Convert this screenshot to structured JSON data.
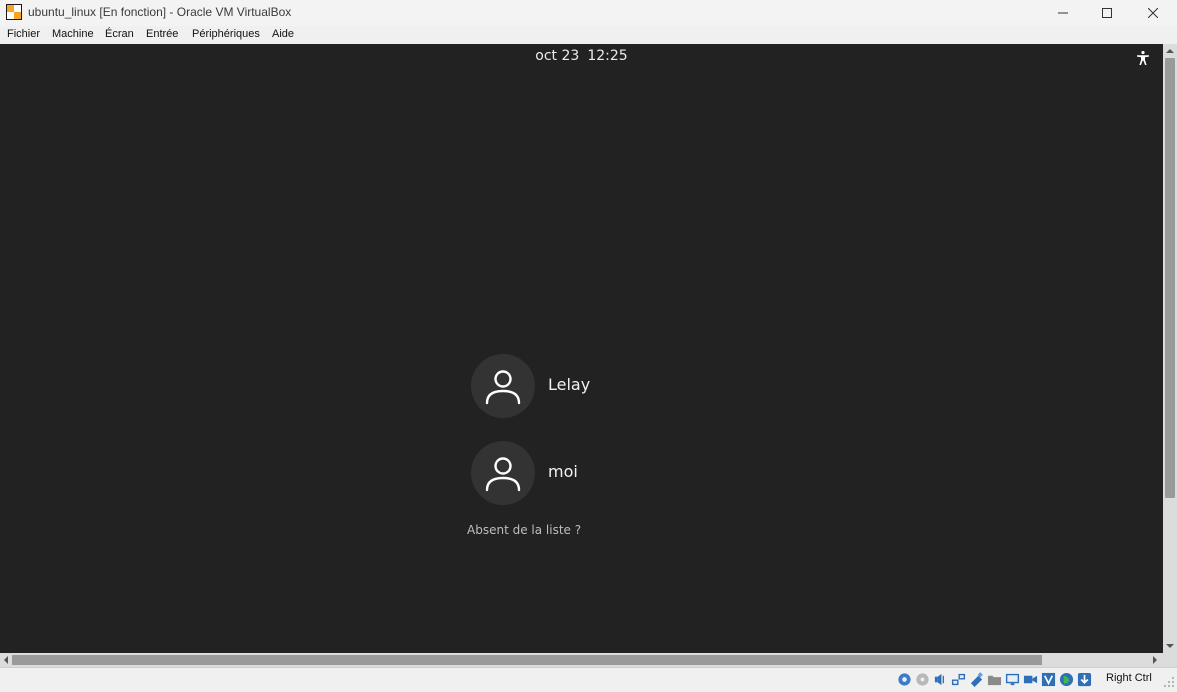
{
  "window": {
    "title": "ubuntu_linux [En fonction] - Oracle VM VirtualBox"
  },
  "menu": {
    "items": [
      {
        "label": "Fichier"
      },
      {
        "label": "Machine"
      },
      {
        "label": "Écran"
      },
      {
        "label": "Entrée"
      },
      {
        "label": "Périphériques"
      },
      {
        "label": "Aide"
      }
    ]
  },
  "login": {
    "date": "oct 23",
    "time": "12:25",
    "users": [
      {
        "name": "Lelay"
      },
      {
        "name": "moi"
      }
    ],
    "not_listed": "Absent de la liste ?"
  },
  "statusbar": {
    "host_key": "Right Ctrl",
    "icons": [
      "hard-disk-icon",
      "optical-drive-icon",
      "audio-icon",
      "network-icon",
      "usb-icon",
      "shared-folders-icon",
      "display-icon",
      "video-capture-icon",
      "virtualization-icon",
      "mouse-integration-icon",
      "host-key-icon"
    ]
  },
  "colors": {
    "vm_background": "#222222",
    "avatar_background": "#333333",
    "text_primary": "#f2f2f2",
    "text_secondary": "#bdbdbd"
  }
}
